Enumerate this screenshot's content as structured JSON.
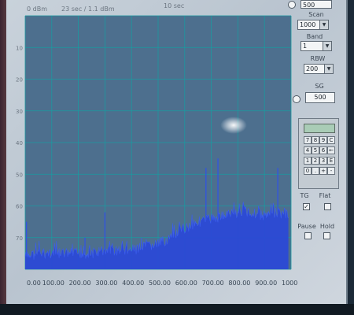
{
  "plot": {
    "header_left": "0 dBm",
    "header_mid": "23 sec / 1.1 dBm",
    "header_right": "10 sec",
    "y_ticks": [
      "10",
      "20",
      "30",
      "40",
      "50",
      "60",
      "70"
    ],
    "x_ticks": [
      "0.00",
      "100.00",
      "200.00",
      "300.00",
      "400.00",
      "500.00",
      "600.00",
      "700.00",
      "800.00",
      "900.00",
      "1000.00"
    ],
    "colors": {
      "background": "#3d5a78",
      "grid": "#1a9aa0",
      "trace": "#2b49d6"
    }
  },
  "chart_data": {
    "type": "area",
    "title": "",
    "xlabel": "",
    "ylabel": "",
    "xlim": [
      0,
      1000
    ],
    "ylim": [
      0,
      80
    ],
    "x": [
      0,
      50,
      100,
      150,
      200,
      250,
      300,
      350,
      400,
      450,
      500,
      550,
      600,
      650,
      700,
      750,
      800,
      850,
      900,
      950,
      990
    ],
    "series": [
      {
        "values": [
          76,
          75,
          75,
          75,
          75,
          75,
          74,
          74,
          74,
          73,
          72,
          70,
          67,
          65,
          64,
          63,
          62,
          62,
          63,
          62,
          63
        ]
      }
    ],
    "spikes": [
      {
        "x": 5,
        "level": 65
      },
      {
        "x": 225,
        "level": 70
      },
      {
        "x": 300,
        "level": 62
      },
      {
        "x": 680,
        "level": 48
      },
      {
        "x": 725,
        "level": 45
      },
      {
        "x": 950,
        "level": 48
      }
    ],
    "grid": true
  },
  "controls": {
    "top_value": "500",
    "scan_label": "Scan",
    "scan_value": "1000",
    "band_label": "Band",
    "band_value": "1",
    "rbw_label": "RBW",
    "rbw_value": "200",
    "sg_label": "SG",
    "sg_value": "500",
    "tg_label": "TG",
    "flat_label": "Flat",
    "pause_label": "Pause",
    "hold_label": "Hold",
    "tg_checked_mark": "✓",
    "keypad": [
      "7",
      "8",
      "9",
      "C",
      "4",
      "5",
      "6",
      "←",
      "1",
      "2",
      "3",
      "E",
      "0",
      ".",
      "+",
      "-"
    ]
  }
}
